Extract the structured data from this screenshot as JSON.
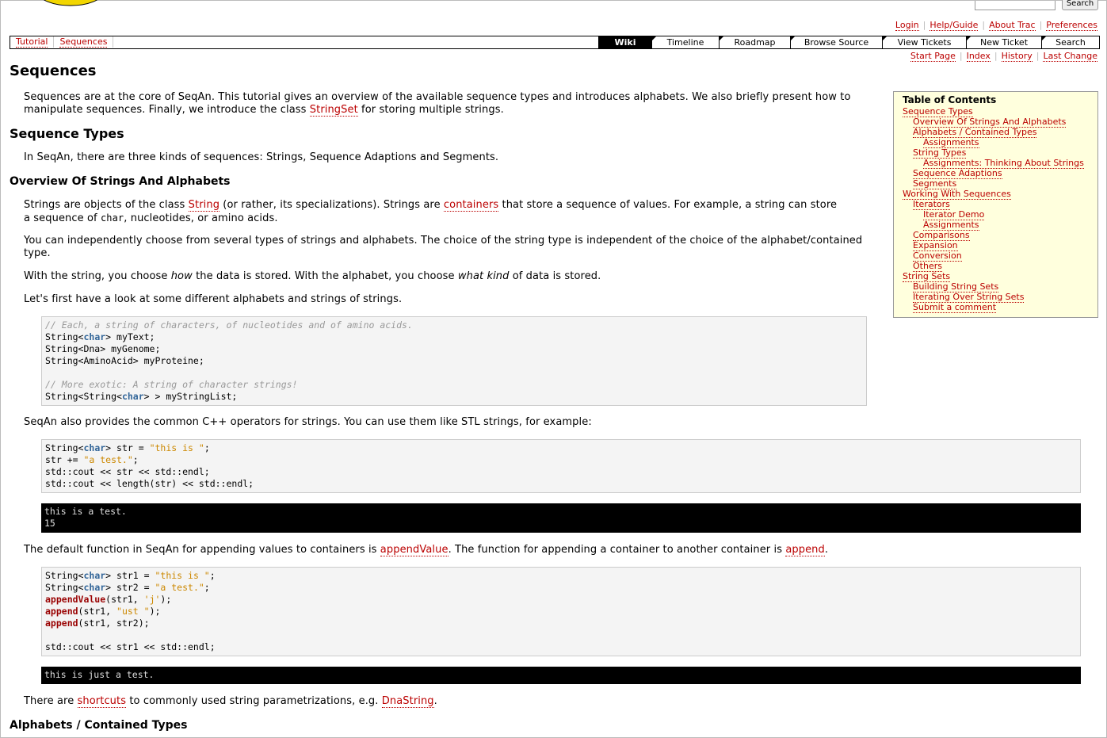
{
  "header": {
    "search_label": "Search",
    "metanav": [
      "Login",
      "Help/Guide",
      "About Trac",
      "Preferences"
    ]
  },
  "ctxnav": [
    "Tutorial",
    "Sequences"
  ],
  "mainnav": [
    "Wiki",
    "Timeline",
    "Roadmap",
    "Browse Source",
    "View Tickets",
    "New Ticket",
    "Search"
  ],
  "pagenav": [
    "Start Page",
    "Index",
    "History",
    "Last Change"
  ],
  "page": {
    "title": "Sequences",
    "intro_a": "Sequences are at the core of SeqAn. This tutorial gives an overview of the available sequence types and introduces alphabets. We also briefly present how to",
    "intro_b": "manipulate sequences. Finally, we introduce the class ",
    "intro_link": "StringSet",
    "intro_c": " for storing multiple strings.",
    "h_sequence_types": "Sequence Types",
    "seq_types_text": "In SeqAn, there are three kinds of sequences: Strings, Sequence Adaptions and Segments.",
    "h_overview": "Overview Of Strings And Alphabets",
    "p1_a": "Strings are objects of the class ",
    "p1_link1": "String",
    "p1_b": " (or rather, its specializations). Strings are ",
    "p1_link2": "containers",
    "p1_c": " that store a sequence of values. For example, a string can store",
    "p1_d": "a sequence of ",
    "p1_code": "char",
    "p1_e": ", nucleotides, or amino acids.",
    "p2_a": "You can independently choose from several types of strings and alphabets. The choice of the string type is independent of the choice of the alphabet/contained",
    "p2_b": "type.",
    "p3_a": "With the string, you choose ",
    "p3_em1": "how",
    "p3_b": " the data is stored. With the alphabet, you choose ",
    "p3_em2": "what kind",
    "p3_c": " of data is stored.",
    "p4": "Let's first have a look at some different alphabets and strings of strings.",
    "p5": "SeqAn also provides the common C++ operators for strings. You can use them like STL strings, for example:",
    "p6_a": "The default function in SeqAn for appending values to containers is ",
    "p6_link1": "appendValue",
    "p6_b": ". The function for appending a container to another container is ",
    "p6_link2": "append",
    "p6_c": ".",
    "p7_a": "There are ",
    "p7_link1": "shortcuts",
    "p7_b": " to commonly used string parametrizations, e.g. ",
    "p7_link2": "DnaString",
    "p7_c": ".",
    "h_alphabets": "Alphabets / Contained Types"
  },
  "code1": [
    "// Each, a string of characters, of nucleotides and of amino acids.",
    "String<char> myText;",
    "String<Dna> myGenome;",
    "String<AminoAcid> myProteine;",
    "",
    "// More exotic: A string of character strings!",
    "String<String<char> > myStringList;"
  ],
  "code2": [
    "String<char> str = \"this is \";",
    "str += \"a test.\";",
    "std::cout << str << std::endl;",
    "std::cout << length(str) << std::endl;"
  ],
  "out2": [
    "this is a test.",
    "15"
  ],
  "code3": [
    "String<char> str1 = \"this is \";",
    "String<char> str2 = \"a test.\";",
    "appendValue(str1, 'j');",
    "append(str1, \"ust \");",
    "append(str1, str2);",
    "",
    "std::cout << str1 << std::endl;"
  ],
  "out3": [
    "this is just a test."
  ],
  "toc": {
    "title": "Table of Contents",
    "items": [
      {
        "label": "Sequence Types",
        "level": 1
      },
      {
        "label": "Overview Of Strings And Alphabets",
        "level": 2
      },
      {
        "label": "Alphabets / Contained Types",
        "level": 2
      },
      {
        "label": "Assignments",
        "level": 3
      },
      {
        "label": "String Types",
        "level": 2
      },
      {
        "label": "Assignments: Thinking About Strings",
        "level": 3
      },
      {
        "label": "Sequence Adaptions",
        "level": 2
      },
      {
        "label": "Segments",
        "level": 2
      },
      {
        "label": "Working With Sequences",
        "level": 1
      },
      {
        "label": "Iterators",
        "level": 2
      },
      {
        "label": "Iterator Demo",
        "level": 3
      },
      {
        "label": "Assignments",
        "level": 3
      },
      {
        "label": "Comparisons",
        "level": 2
      },
      {
        "label": "Expansion",
        "level": 2
      },
      {
        "label": "Conversion",
        "level": 2
      },
      {
        "label": "Others",
        "level": 2
      },
      {
        "label": "String Sets",
        "level": 1
      },
      {
        "label": "Building String Sets",
        "level": 2
      },
      {
        "label": "Iterating Over String Sets",
        "level": 2
      },
      {
        "label": "Submit a comment",
        "level": 2
      }
    ]
  }
}
